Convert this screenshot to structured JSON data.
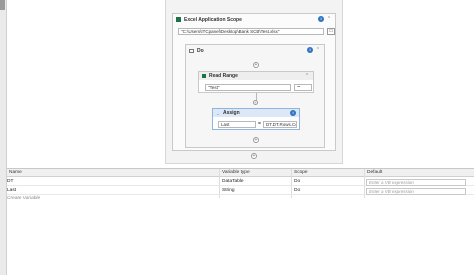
{
  "designer": {
    "excel_scope": {
      "title": "Excel Application Scope",
      "path_value": "\"C:\\Users\\ITCpanel\\Desktop\\Bank SCB\\Test.xlsx\""
    },
    "do_sequence": {
      "title": "Do"
    },
    "read_range": {
      "title": "Read Range",
      "sheet_value": "\"Test\"",
      "range_value": "\"\""
    },
    "assign": {
      "title": "Assign",
      "to_value": "Last",
      "equals": "=",
      "value_value": "DT.DT.Rows.Co"
    },
    "glyphs": {
      "info": "i",
      "chevron": "⌃",
      "plus": "+",
      "folder": "▭",
      "menu": "⋯"
    }
  },
  "variables": {
    "headers": {
      "name": "Name",
      "type": "Variable type",
      "scope": "Scope",
      "default": "Default"
    },
    "rows": [
      {
        "name": "DT",
        "type": "DataTable",
        "scope": "Do",
        "default_placeholder": "Enter a VB expression"
      },
      {
        "name": "Last",
        "type": "String",
        "scope": "Do",
        "default_placeholder": "Enter a VB expression"
      }
    ],
    "create_label": "Create Variable"
  },
  "colors": {
    "accent": "#2f73c2",
    "panel": "#f3f3f3"
  }
}
